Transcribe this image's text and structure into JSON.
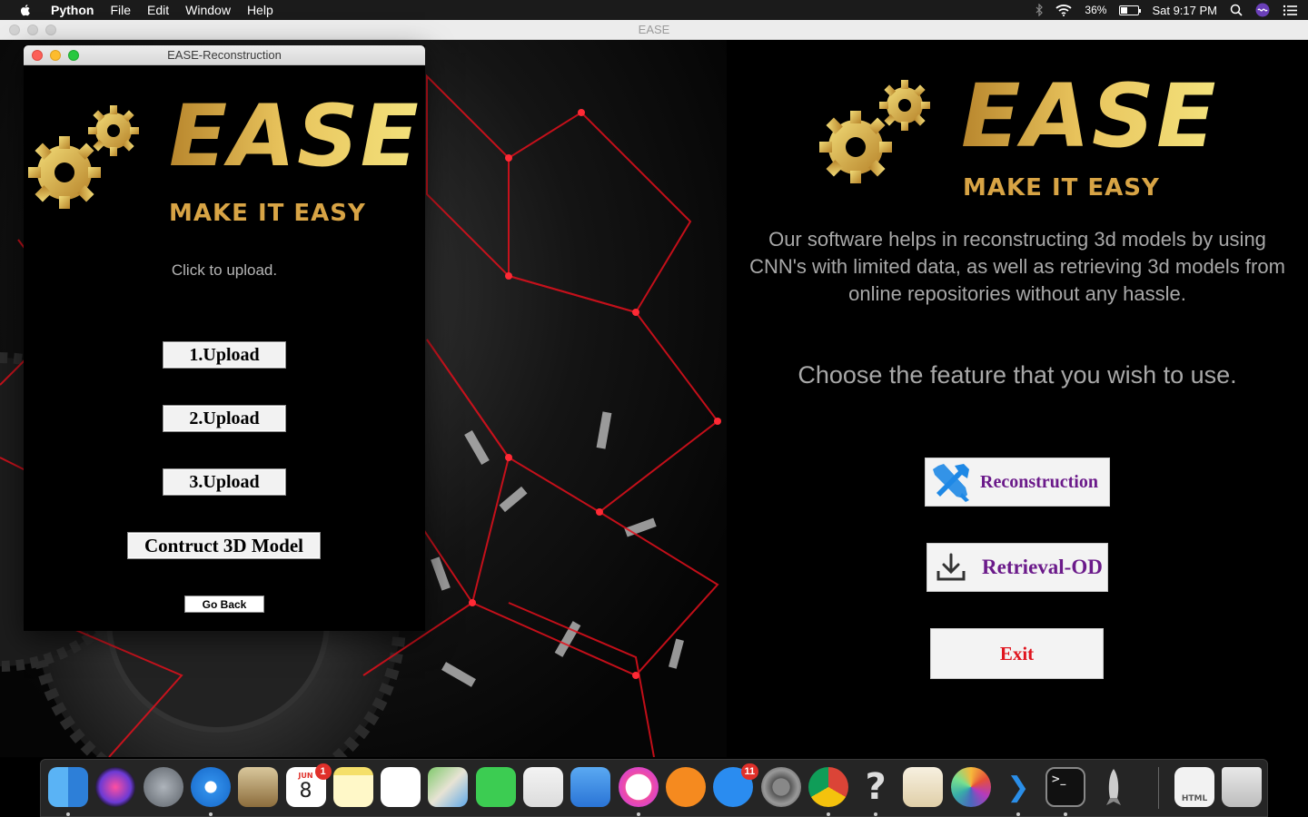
{
  "menubar": {
    "app_name": "Python",
    "items": [
      "File",
      "Edit",
      "Window",
      "Help"
    ],
    "battery_percent": "36%",
    "battery_level": 0.36,
    "datetime": "Sat 9:17 PM"
  },
  "main_window": {
    "title": "EASE",
    "logo_word": "EASE",
    "logo_tagline": "MAKE IT EASY",
    "description": "Our software helps in reconstructing 3d models by using CNN's with limited data, as well as retrieving 3d models from online repositories without any hassle.",
    "prompt": "Choose the feature that you wish to use.",
    "buttons": {
      "reconstruction": "Reconstruction",
      "retrieval": "Retrieval-OD",
      "exit": "Exit"
    },
    "colors": {
      "feature_label": "#6b1a8a",
      "exit_label": "#e0141e",
      "gold": "#d4aa3e"
    }
  },
  "child_window": {
    "title": "EASE-Reconstruction",
    "logo_word": "EASE",
    "logo_tagline": "MAKE IT EASY",
    "instruction": "Click to upload.",
    "upload1": "1.Upload",
    "upload2": "2.Upload",
    "upload3": "3.Upload",
    "construct": "Contruct 3D Model",
    "go_back": "Go Back"
  },
  "dock": {
    "apps": [
      {
        "name": "Finder",
        "icon": "finder-icon",
        "running": true
      },
      {
        "name": "Siri",
        "icon": "siri-icon",
        "running": false
      },
      {
        "name": "Launchpad",
        "icon": "launchpad-icon",
        "running": false
      },
      {
        "name": "Safari",
        "icon": "safari-icon",
        "running": true
      },
      {
        "name": "Mail",
        "icon": "mail-icon",
        "running": false
      },
      {
        "name": "Calendar",
        "icon": "calendar-icon",
        "running": false,
        "badge": "1",
        "month": "JUN",
        "day": "8"
      },
      {
        "name": "Notes",
        "icon": "notes-icon",
        "running": false
      },
      {
        "name": "Reminders",
        "icon": "reminders-icon",
        "running": false
      },
      {
        "name": "Maps",
        "icon": "maps-icon",
        "running": false
      },
      {
        "name": "FaceTime",
        "icon": "facetime-icon",
        "running": false
      },
      {
        "name": "Numbers",
        "icon": "numbers-icon",
        "running": false
      },
      {
        "name": "Keynote",
        "icon": "keynote-icon",
        "running": false
      },
      {
        "name": "iTunes",
        "icon": "itunes-icon",
        "running": true
      },
      {
        "name": "iBooks",
        "icon": "ibooks-icon",
        "running": false
      },
      {
        "name": "App Store",
        "icon": "app-store-icon",
        "running": false,
        "badge": "11"
      },
      {
        "name": "System Preferences",
        "icon": "system-preferences-icon",
        "running": false
      },
      {
        "name": "Chrome",
        "icon": "chrome-icon",
        "running": true
      },
      {
        "name": "Python",
        "icon": "help-question-icon",
        "running": true
      },
      {
        "name": "Preview",
        "icon": "preview-icon",
        "running": false
      },
      {
        "name": "Photos",
        "icon": "photos-icon",
        "running": false
      },
      {
        "name": "Visual Studio Code",
        "icon": "vscode-icon",
        "running": true
      },
      {
        "name": "Terminal",
        "icon": "terminal-icon",
        "running": true
      },
      {
        "name": "Rocket",
        "icon": "rocket-icon",
        "running": false
      },
      {
        "name": "HTML Document",
        "icon": "html-file-icon",
        "running": false,
        "label": "HTML"
      },
      {
        "name": "Trash",
        "icon": "trash-icon",
        "running": false
      }
    ]
  }
}
